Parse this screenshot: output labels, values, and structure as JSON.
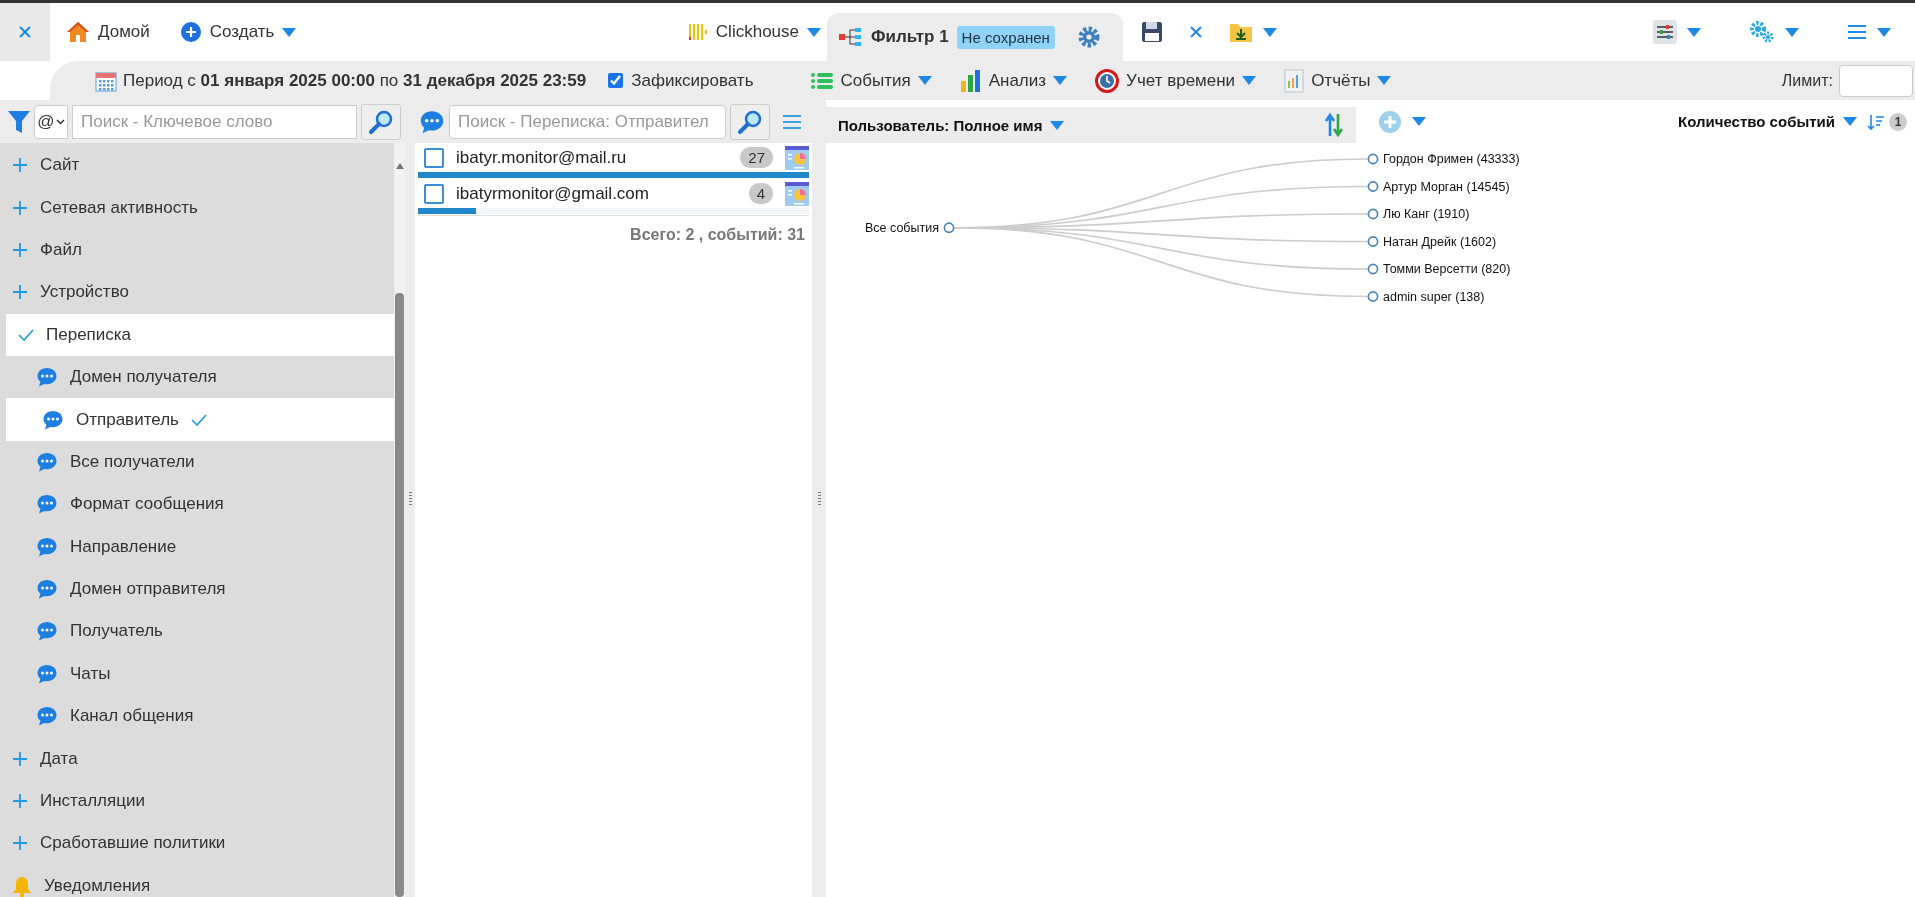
{
  "top_bar": {
    "home": "Домой",
    "create": "Создать",
    "database": "Clickhouse",
    "filter_tab": {
      "title": "Фильтр 1",
      "status": "Не сохранен",
      "selected": true
    }
  },
  "period": {
    "text": "Период с **01 января 2025 00:00** по **31 декабря 2025 23:59**",
    "lock": {
      "label": "Зафиксировать",
      "checked": true
    }
  },
  "menus": [
    {
      "label": "События",
      "kind": "events"
    },
    {
      "label": "Анализ",
      "kind": "analysis"
    },
    {
      "label": "Учет времени",
      "kind": "time"
    },
    {
      "label": "Отчёты",
      "kind": "reports"
    }
  ],
  "limit": {
    "label": "Лимит:"
  },
  "sidebar": {
    "search": {
      "mode": "@",
      "placeholder": "Поиск - Ключевое слово"
    },
    "items": [
      {
        "label": "Сайт",
        "kind": "group",
        "expanded": false,
        "selected": false
      },
      {
        "label": "Сетевая активность",
        "kind": "group",
        "expanded": false,
        "selected": false
      },
      {
        "label": "Файл",
        "kind": "group",
        "expanded": false,
        "selected": false
      },
      {
        "label": "Устройство",
        "kind": "group",
        "expanded": false,
        "selected": false
      },
      {
        "label": "Переписка",
        "kind": "group",
        "expanded": true,
        "selected": true,
        "children": [
          {
            "label": "Домен получателя",
            "selected": false
          },
          {
            "label": "Отправитель",
            "selected": true
          },
          {
            "label": "Все получатели",
            "selected": false
          },
          {
            "label": "Формат сообщения",
            "selected": false
          },
          {
            "label": "Направление",
            "selected": false
          },
          {
            "label": "Домен отправителя",
            "selected": false
          },
          {
            "label": "Получатель",
            "selected": false
          },
          {
            "label": "Чаты",
            "selected": false
          },
          {
            "label": "Канал общения",
            "selected": false
          }
        ]
      },
      {
        "label": "Дата",
        "kind": "group",
        "expanded": false,
        "selected": false
      },
      {
        "label": "Инсталляции",
        "kind": "group",
        "expanded": false,
        "selected": false
      },
      {
        "label": "Сработавшие политики",
        "kind": "group",
        "expanded": false,
        "selected": false
      },
      {
        "label": "Уведомления",
        "kind": "alert",
        "selected": false
      }
    ]
  },
  "list_panel": {
    "search": {
      "placeholder": "Поиск - Переписка: Отправител"
    },
    "rows": [
      {
        "address": "ibatyr.monitor@mail.ru",
        "count": "27",
        "checked": false,
        "level": 1
      },
      {
        "address": "ibatyrmonitor@gmail.com",
        "count": "4",
        "checked": false,
        "level": 0.148
      }
    ],
    "summary": "Всего: 2 , событий: 31"
  },
  "tree_panel": {
    "group_by": "Пользователь: Полное имя",
    "metric": "Количество событий",
    "sort_badge": "1",
    "root": {
      "label": "Все события",
      "children": [
        {
          "label": "Гордон Фримен (43333)"
        },
        {
          "label": "Артур Морган (14545)"
        },
        {
          "label": "Лю Канг (1910)"
        },
        {
          "label": "Натан Дрейк (1602)"
        },
        {
          "label": "Томми Версетти (820)"
        },
        {
          "label": "admin super (138)"
        }
      ]
    }
  }
}
